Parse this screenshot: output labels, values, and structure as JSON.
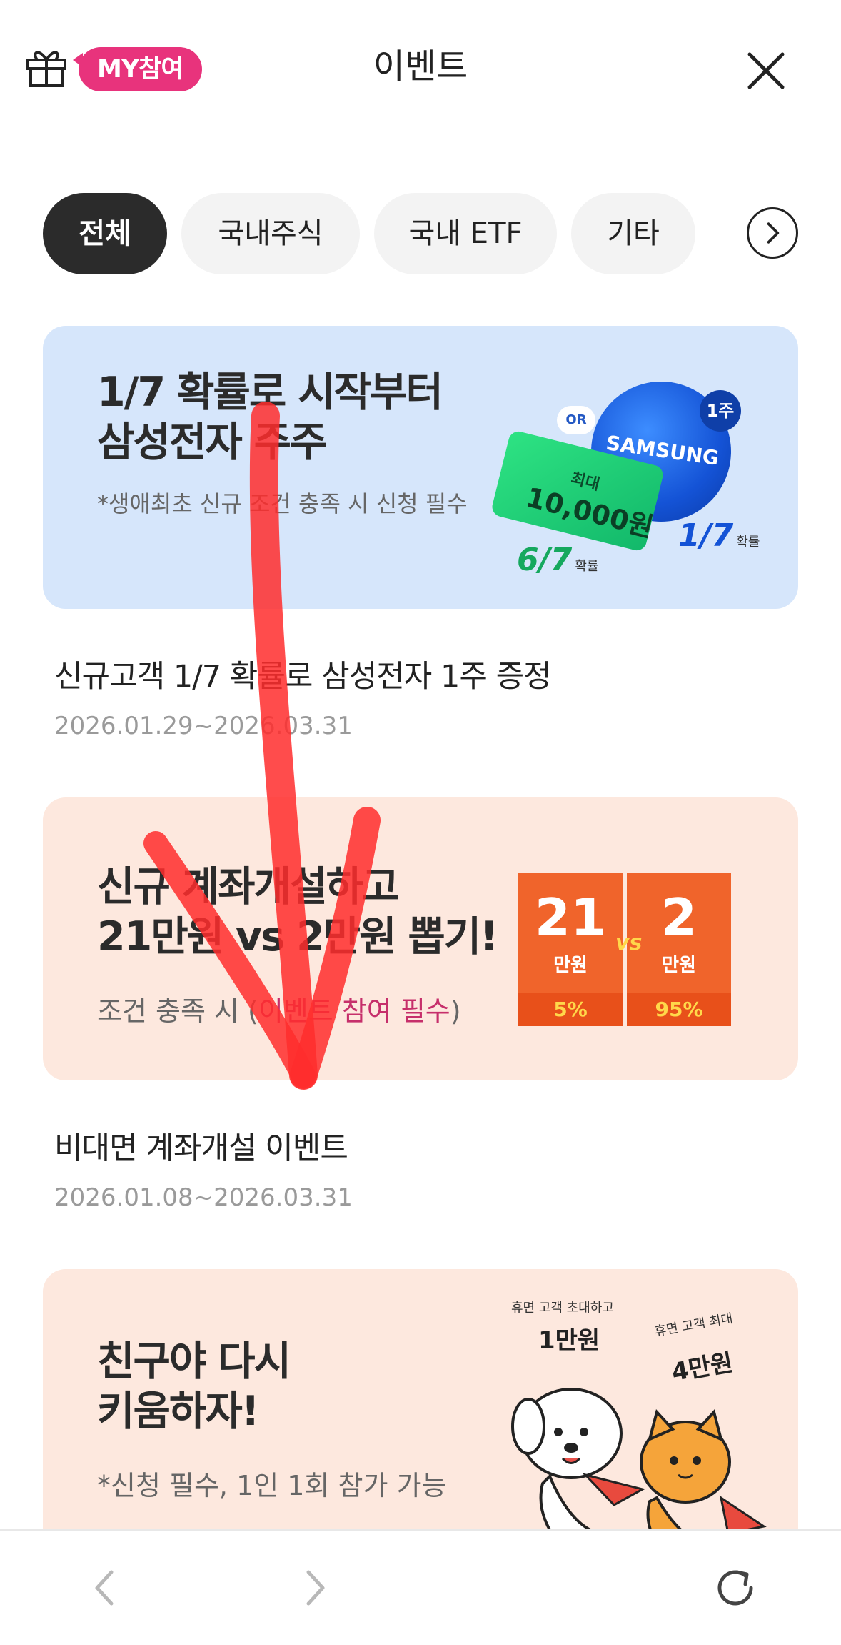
{
  "header": {
    "my_badge": "MY참여",
    "title": "이벤트"
  },
  "tabs": [
    {
      "label": "전체",
      "active": true
    },
    {
      "label": "국내주식",
      "active": false
    },
    {
      "label": "국내 ETF",
      "active": false
    },
    {
      "label": "기타",
      "active": false
    }
  ],
  "events": [
    {
      "banner_title_line1": "1/7 확률로 시작부터",
      "banner_title_line2": "삼성전자 주주",
      "banner_sub": "*생애최초 신규 조건 충족 시 신청 필수",
      "art": {
        "or_badge": "OR",
        "ball_text": "SAMSUNG",
        "ball_badge": "1주",
        "ticket_small": "최대",
        "ticket_big": "10,000원",
        "prob_left": "6/7",
        "prob_right": "1/7",
        "prob_suffix": "확률"
      },
      "title": "신규고객 1/7 확률로 삼성전자 1주 증정",
      "date": "2026.01.29~2026.03.31",
      "bg_color": "#d6e6fb"
    },
    {
      "banner_title_line1": "신규 계좌개설하고",
      "banner_title_line2": "21만원 vs 2만원 뽑기!",
      "banner_sub_plain": "조건 충족 시 (",
      "banner_sub_pink": "이벤트 참여 필수",
      "banner_sub_close": ")",
      "art": {
        "left_amount": "21",
        "left_unit": "만원",
        "left_pct": "5%",
        "vs": "vs",
        "right_amount": "2",
        "right_unit": "만원",
        "right_pct": "95%"
      },
      "title": "비대면 계좌개설 이벤트",
      "date": "2026.01.08~2026.03.31",
      "bg_color": "#fde8de"
    },
    {
      "banner_title_line1": "친구야 다시",
      "banner_title_line2": "키움하자!",
      "banner_sub": "*신청 필수, 1인 1회 참가 가능",
      "art": {
        "left_small": "휴면 고객 초대하고",
        "left_big": "1만원",
        "right_small": "휴면 고객 최대",
        "right_big": "4만원"
      },
      "bg_color": "#fde8de"
    }
  ],
  "colors": {
    "accent_pink": "#e8337c",
    "active_tab": "#2b2b2b",
    "annotation_arrow": "#ff3b3b"
  },
  "icons": [
    "gift-icon",
    "close-icon",
    "chevron-right-icon",
    "back-icon",
    "forward-icon",
    "refresh-icon"
  ]
}
